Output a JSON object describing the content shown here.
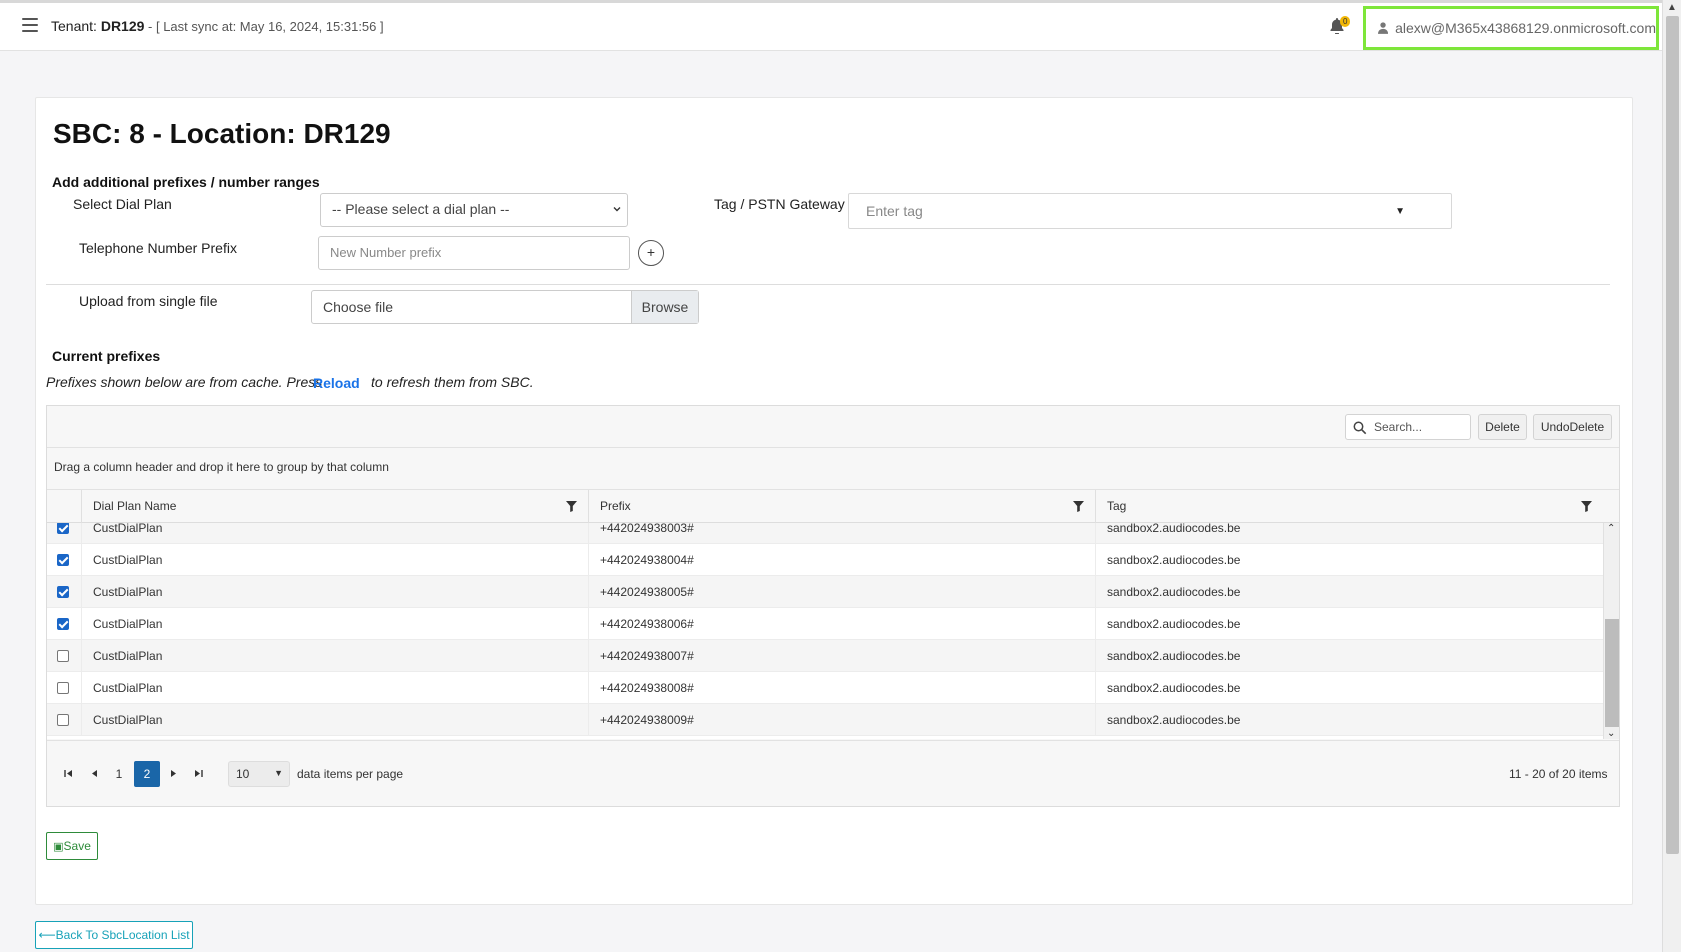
{
  "header": {
    "tenant_label": "Tenant:",
    "tenant_name": "DR129",
    "sync_text": " - [ Last sync at: May 16, 2024, 15:31:56 ]",
    "notification_count": "0",
    "user_email": "alexw@M365x43868129.onmicrosoft.com"
  },
  "page": {
    "title": "SBC: 8 - Location: DR129"
  },
  "form": {
    "add_heading": "Add additional prefixes / number ranges",
    "dial_plan_label": "Select Dial Plan",
    "dial_plan_value": "-- Please select a dial plan --",
    "tag_label": "Tag / PSTN Gateway",
    "tag_placeholder": "Enter tag",
    "prefix_label": "Telephone Number Prefix",
    "prefix_placeholder": "New Number prefix",
    "add_symbol": "+",
    "upload_label": "Upload from single file",
    "file_placeholder": "Choose file",
    "browse_label": "Browse"
  },
  "current": {
    "heading": "Current prefixes",
    "note_before": "Prefixes shown below are from cache. Press",
    "reload_label": "Reload",
    "note_after": "to refresh them from SBC."
  },
  "grid": {
    "search_placeholder": "Search...",
    "delete_label": "Delete",
    "undo_label": "UndoDelete",
    "group_hint": "Drag a column header and drop it here to group by that column",
    "columns": [
      "Dial Plan Name",
      "Prefix",
      "Tag"
    ],
    "rows": [
      {
        "checked": true,
        "dial_plan": "CustDialPlan",
        "prefix": "+442024938003#",
        "tag": "sandbox2.audiocodes.be"
      },
      {
        "checked": true,
        "dial_plan": "CustDialPlan",
        "prefix": "+442024938004#",
        "tag": "sandbox2.audiocodes.be"
      },
      {
        "checked": true,
        "dial_plan": "CustDialPlan",
        "prefix": "+442024938005#",
        "tag": "sandbox2.audiocodes.be"
      },
      {
        "checked": true,
        "dial_plan": "CustDialPlan",
        "prefix": "+442024938006#",
        "tag": "sandbox2.audiocodes.be"
      },
      {
        "checked": false,
        "dial_plan": "CustDialPlan",
        "prefix": "+442024938007#",
        "tag": "sandbox2.audiocodes.be"
      },
      {
        "checked": false,
        "dial_plan": "CustDialPlan",
        "prefix": "+442024938008#",
        "tag": "sandbox2.audiocodes.be"
      },
      {
        "checked": false,
        "dial_plan": "CustDialPlan",
        "prefix": "+442024938009#",
        "tag": "sandbox2.audiocodes.be"
      }
    ],
    "pager": {
      "pages": [
        "1",
        "2"
      ],
      "active_page": "2",
      "per_page": "10",
      "per_page_label": "data items per page",
      "summary": "11 - 20 of 20 items"
    }
  },
  "actions": {
    "save_label": "Save",
    "back_label": "Back To SbcLocation List"
  },
  "colors": {
    "accent": "#1a66a8",
    "link": "#1a73e8",
    "save_green": "#2e8b3a",
    "back_teal": "#17a2b8",
    "highlight_border": "#7ee63a"
  }
}
